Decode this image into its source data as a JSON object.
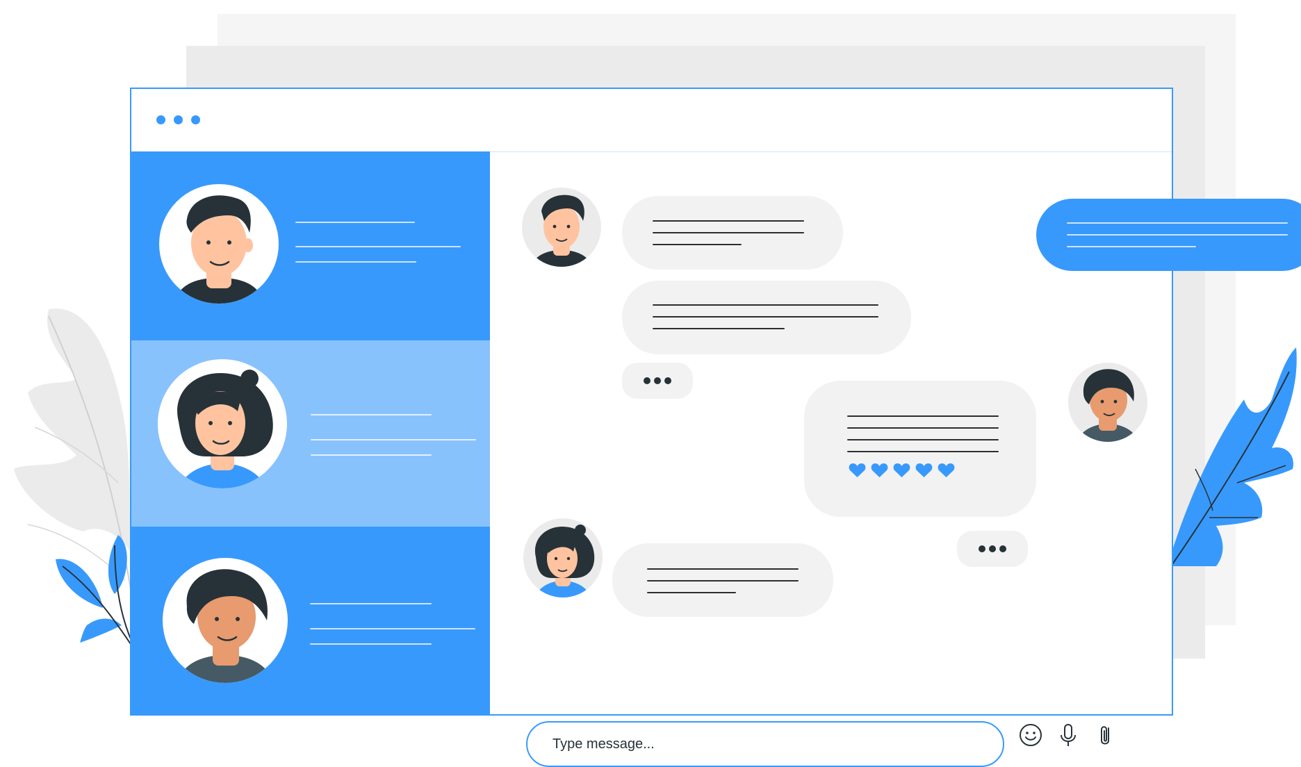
{
  "window": {
    "control_dots": [
      "dot-1",
      "dot-2",
      "dot-3"
    ]
  },
  "colors": {
    "accent": "#3899fc",
    "accent_light": "#88c2fd",
    "bubble_gray": "#f2f2f2",
    "dark": "#263238",
    "skin_1": "#ffc3a0",
    "skin_2": "#e79b6f"
  },
  "contacts": [
    {
      "id": "contact-man",
      "selected": false
    },
    {
      "id": "contact-woman",
      "selected": true
    },
    {
      "id": "contact-curly",
      "selected": false
    }
  ],
  "chat": {
    "reaction_icons": [
      "heart-icon",
      "heart-icon",
      "heart-icon",
      "heart-icon",
      "heart-icon"
    ],
    "composer": {
      "placeholder": "Type message..."
    },
    "toolbar_icons": [
      "emoji-icon",
      "microphone-icon",
      "paperclip-icon"
    ]
  }
}
